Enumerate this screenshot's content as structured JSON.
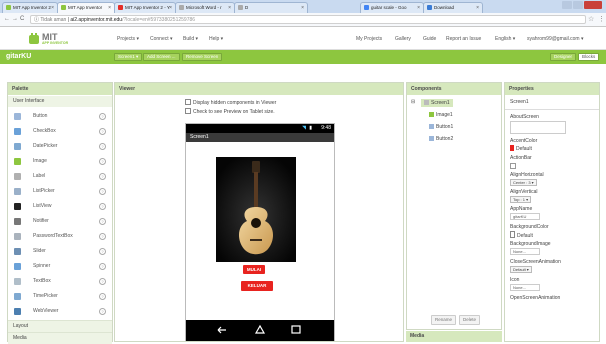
{
  "browser": {
    "tabs": [
      {
        "label": "MIT App Inventor 2"
      },
      {
        "label": "MIT App Inventor"
      },
      {
        "label": "MIT App Inventor 2 - Y"
      },
      {
        "label": "Microsoft Word - r"
      },
      {
        "label": "D"
      },
      {
        "label": "guitar scale - Goo"
      },
      {
        "label": "Download"
      }
    ],
    "url_scheme": "Tidak aman",
    "url_host": "ai2.appinventor.mit.edu",
    "url_path": "/?locale=en#5973380251259786"
  },
  "app": {
    "logo_text": "MIT",
    "logo_sub": "APP INVENTOR",
    "menu": [
      "Projects ▾",
      "Connect ▾",
      "Build ▾",
      "Help ▾"
    ],
    "right_menu": [
      "My Projects",
      "Gallery",
      "Guide",
      "Report an Issue",
      "English ▾",
      "syahrom99@gmail.com ▾"
    ],
    "project_name": "gitarKU",
    "screen_select": "Screen1 ▾",
    "add_screen": "Add Screen ...",
    "remove_screen": "Remove Screen",
    "designer": "Designer",
    "blocks": "Blocks",
    "accent": "#8dc63f"
  },
  "palette": {
    "title": "Palette",
    "section": "User Interface",
    "items": [
      {
        "label": "Button",
        "icon": "button-icon"
      },
      {
        "label": "CheckBox",
        "icon": "checkbox-icon"
      },
      {
        "label": "DatePicker",
        "icon": "datepicker-icon"
      },
      {
        "label": "Image",
        "icon": "image-icon"
      },
      {
        "label": "Label",
        "icon": "label-icon"
      },
      {
        "label": "ListPicker",
        "icon": "listpicker-icon"
      },
      {
        "label": "ListView",
        "icon": "listview-icon"
      },
      {
        "label": "Notifier",
        "icon": "notifier-icon"
      },
      {
        "label": "PasswordTextBox",
        "icon": "password-icon"
      },
      {
        "label": "Slider",
        "icon": "slider-icon"
      },
      {
        "label": "Spinner",
        "icon": "spinner-icon"
      },
      {
        "label": "TextBox",
        "icon": "textbox-icon"
      },
      {
        "label": "TimePicker",
        "icon": "timepicker-icon"
      },
      {
        "label": "WebViewer",
        "icon": "webviewer-icon"
      }
    ],
    "layout_section": "Layout",
    "media_section": "Media",
    "help_glyph": "?"
  },
  "viewer": {
    "title": "Viewer",
    "option1": "Display hidden components in Viewer",
    "option2": "Check to see Preview on Tablet size.",
    "status_time": "9:48",
    "screen_title": "Screen1",
    "button1": "MULAI",
    "button2": "KELUAR"
  },
  "components": {
    "title": "Components",
    "tree": [
      "Screen1",
      "Image1",
      "Button1",
      "Button2"
    ],
    "rename": "Rename",
    "delete": "Delete",
    "media": "Media"
  },
  "properties": {
    "title": "Properties",
    "screen": "Screen1",
    "about": "AboutScreen",
    "accent_label": "AccentColor",
    "accent_value": "Default",
    "actionbar": "ActionBar",
    "align_h": "AlignHorizontal",
    "align_h_value": "Center : 3 ▾",
    "align_v": "AlignVertical",
    "align_v_value": "Top : 1 ▾",
    "appname": "AppName",
    "appname_value": "gitarKU",
    "bgcolor": "BackgroundColor",
    "bgcolor_value": "Default",
    "bgimage": "BackgroundImage",
    "bgimage_value": "None...",
    "close_anim": "CloseScreenAnimation",
    "close_anim_value": "Default ▾",
    "icon": "Icon",
    "icon_value": "None...",
    "open_anim": "OpenScreenAnimation"
  }
}
